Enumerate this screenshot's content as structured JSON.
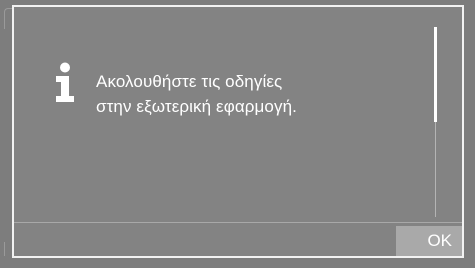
{
  "dialog": {
    "message_lines": [
      "Ακολουθήστε τις οδηγίες",
      "στην εξωτερική εφαρμογή."
    ],
    "icon": "info-icon",
    "ok_label": "OK"
  },
  "colors": {
    "background": "#7d7d7d",
    "dialog_background": "#838383",
    "border": "#f2f2f2",
    "button": "#a9a9a9",
    "text": "#ffffff"
  }
}
